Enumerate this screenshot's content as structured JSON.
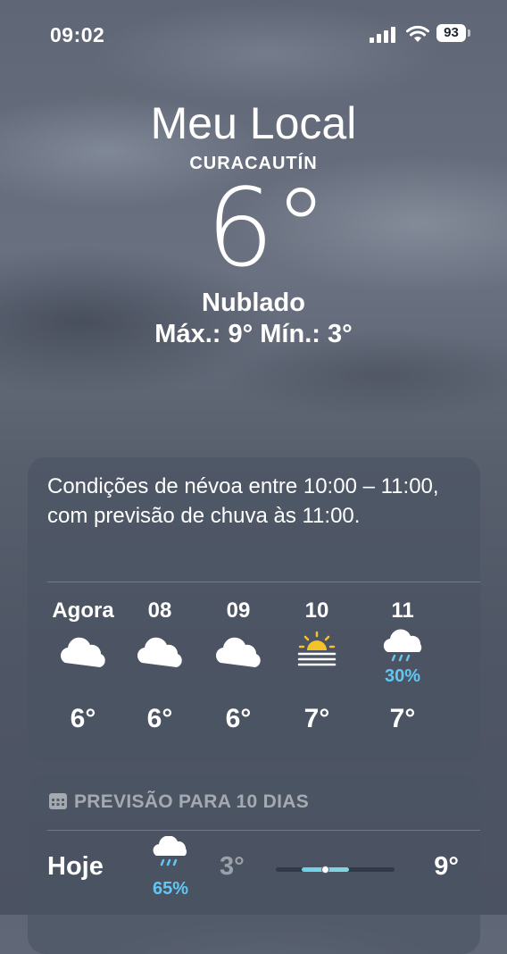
{
  "status_bar": {
    "time": "09:02",
    "battery": "93"
  },
  "header": {
    "title": "Meu Local",
    "location": "CURACAUTÍN",
    "temperature": "6°",
    "condition": "Nublado",
    "high_low": "Máx.: 9°  Mín.: 3°"
  },
  "hourly": {
    "summary": "Condições de névoa entre 10:00 – 11:00, com previsão de chuva às 11:00.",
    "items": [
      {
        "label": "Agora",
        "icon": "cloud-icon",
        "temp": "6°",
        "precip": ""
      },
      {
        "label": "08",
        "icon": "cloud-icon",
        "temp": "6°",
        "precip": ""
      },
      {
        "label": "09",
        "icon": "cloud-icon",
        "temp": "6°",
        "precip": ""
      },
      {
        "label": "10",
        "icon": "fog-sun-icon",
        "temp": "7°",
        "precip": ""
      },
      {
        "label": "11",
        "icon": "cloud-rain-icon",
        "temp": "7°",
        "precip": "30%"
      }
    ]
  },
  "daily": {
    "header": "PREVISÃO PARA 10 DIAS",
    "days": [
      {
        "name": "Hoje",
        "icon": "cloud-rain-icon",
        "precip": "65%",
        "min": "3°",
        "max": "9°",
        "range_start": 0.22,
        "range_end": 0.62,
        "current": 0.42
      }
    ]
  },
  "colors": {
    "precip": "#62c6f2",
    "sun": "#f6c22a"
  }
}
